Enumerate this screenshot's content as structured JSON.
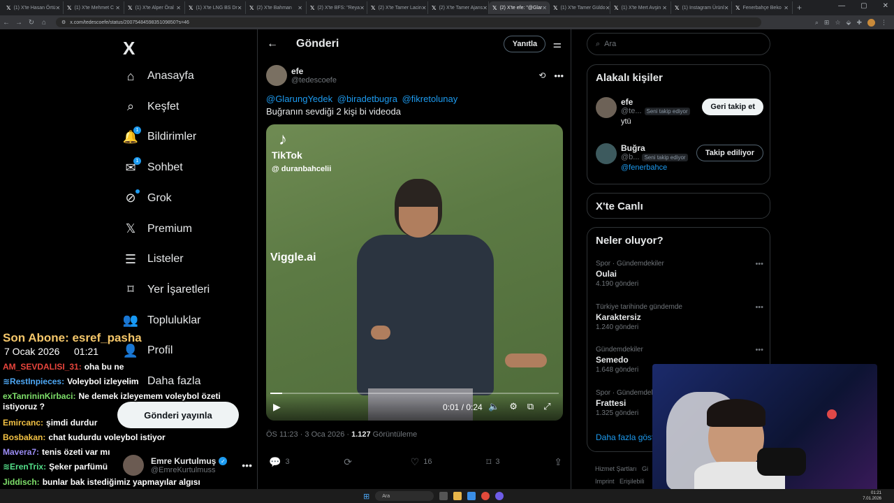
{
  "browser": {
    "tabs": [
      {
        "label": "(1) X'te Hasan Örtü"
      },
      {
        "label": "(1) X'te Mehmet C"
      },
      {
        "label": "(1) X'te Alper Öral"
      },
      {
        "label": "(1) X'te LNG BS Dr"
      },
      {
        "label": "(2) X'te Bahman"
      },
      {
        "label": "(2) X'te BFS: \"Reya"
      },
      {
        "label": "(2) X'te Tamer Lacin"
      },
      {
        "label": "(2) X'te Tamer Ajans"
      },
      {
        "label": "(2) X'te efe: \"@Glar"
      },
      {
        "label": "(1) X'te Tamer Güldo"
      },
      {
        "label": "(1) X'te Mert Avşin"
      },
      {
        "label": "(1) Instagram Ürünl"
      },
      {
        "label": "Fenerbahçe Beko"
      }
    ],
    "active_tab": 8,
    "url": "x.com/tedescoefe/status/2007548459835109850?s=46"
  },
  "nav": {
    "logo": "X",
    "items": [
      {
        "label": "Anasayfa",
        "icon": "home-icon"
      },
      {
        "label": "Keşfet",
        "icon": "search-icon"
      },
      {
        "label": "Bildirimler",
        "icon": "bell-icon",
        "badge": "1"
      },
      {
        "label": "Sohbet",
        "icon": "mail-icon",
        "badge": "1"
      },
      {
        "label": "Grok",
        "icon": "grok-icon"
      },
      {
        "label": "Premium",
        "icon": "x-icon"
      },
      {
        "label": "Listeler",
        "icon": "list-icon"
      },
      {
        "label": "Yer İşaretleri",
        "icon": "bookmark-icon"
      },
      {
        "label": "Topluluklar",
        "icon": "communities-icon"
      },
      {
        "label": "Profil",
        "icon": "profile-icon"
      },
      {
        "label": "Daha fazla",
        "icon": "more-icon"
      }
    ],
    "post_button": "Gönderi yayınla",
    "account": {
      "name": "Emre Kurtulmuş",
      "handle": "@EmreKurtulmuss"
    }
  },
  "main": {
    "header_title": "Gönderi",
    "reply_button": "Yanıtla",
    "tweet": {
      "author_name": "efe",
      "author_handle": "@tedescoefe",
      "mentions": [
        "@GlarungYedek",
        "@biradetbugra",
        "@fikretolunay"
      ],
      "text": "Buğranın sevdiği 2 kişi bi videoda",
      "video": {
        "tiktok_label": "TikTok",
        "tiktok_handle": "@ duranbahcelii",
        "watermark": "Viggle.ai",
        "time": "0:01 / 0:24",
        "progress": 0.04
      },
      "time": "ÖS 11:23 · 3 Oca 2026 · ",
      "views": "1.127",
      "views_label": " Görüntüleme",
      "replies": "3",
      "retweets": "",
      "likes": "16",
      "bookmarks": "3"
    }
  },
  "sidebar": {
    "search_placeholder": "Ara",
    "related_title": "Alakalı kişiler",
    "people": [
      {
        "name": "efe",
        "handle": "@te...",
        "follows_you": "Seni takip ediyor",
        "bio": "ytü",
        "button": "Geri takip et"
      },
      {
        "name": "Buğra",
        "handle": "@b...",
        "follows_you": "Seni takip ediyor",
        "bio": "@fenerbahce",
        "button": "Takip ediliyor"
      }
    ],
    "live_title": "X'te Canlı",
    "trends_title": "Neler oluyor?",
    "trends": [
      {
        "category": "Spor · Gündemdekiler",
        "name": "Oulai",
        "posts": "4.190 gönderi"
      },
      {
        "category": "Türkiye tarihinde gündemde",
        "name": "Karaktersiz",
        "posts": "1.240 gönderi"
      },
      {
        "category": "Gündemdekiler",
        "name": "Semedo",
        "posts": "1.648 gönderi"
      },
      {
        "category": "Spor · Gündemdek",
        "name": "Frattesi",
        "posts": "1.325 gönderi"
      }
    ],
    "show_more": "Daha fazla göste",
    "footer": [
      "Hizmet Şartları",
      "Gi",
      "Imprint",
      "Erişilebili"
    ]
  },
  "stream": {
    "last_sub": "Son Abone: esref_pasha",
    "date": "7 Ocak 2026",
    "time": "01:21",
    "messages": [
      {
        "user": "AM_SEVDALISI_31:",
        "text": "oha bu ne",
        "color": "#e8453c"
      },
      {
        "user": "≋RestInpieces:",
        "text": "Voleybol izleyelim",
        "color": "#4ea8f5"
      },
      {
        "user": "exTanrininKirbaci:",
        "text": "Ne demek izleyemem voleybol özeti istiyoruz ?",
        "color": "#7ee06a"
      },
      {
        "user": "Emircanc:",
        "text": "şimdi durdur",
        "color": "#f3c244"
      },
      {
        "user": "Bosbakan:",
        "text": "chat kudurdu voleybol istiyor",
        "color": "#f3c244"
      },
      {
        "user": "Mavera7:",
        "text": "tenis özeti var mı",
        "color": "#9b8cf5"
      },
      {
        "user": "≋ErenTrix:",
        "text": "Şeker parfümü",
        "color": "#54e08a"
      },
      {
        "user": "Jiddisch:",
        "text": "bunlar bak istediğimiz yapmayılar algısı yaymak ya değişmesini istedikleri fln yok",
        "color": "#7ee06a"
      }
    ]
  },
  "taskbar": {
    "search": "Ara",
    "clock_time": "01:21",
    "clock_date": "7.01.2026"
  }
}
